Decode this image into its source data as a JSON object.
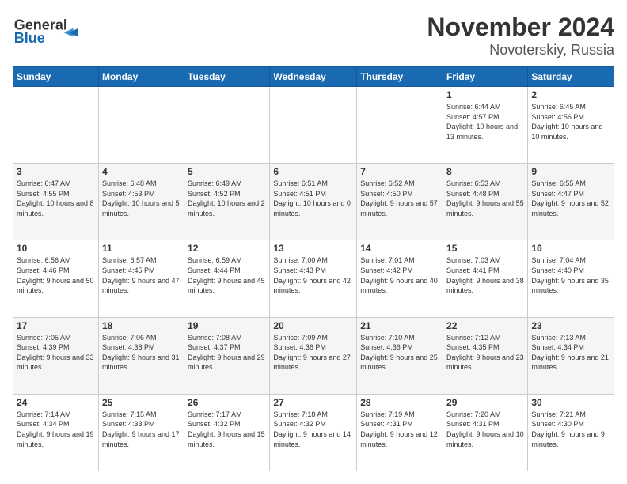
{
  "header": {
    "logo_line1": "General",
    "logo_line2": "Blue",
    "title": "November 2024",
    "subtitle": "Novoterskiy, Russia"
  },
  "days_of_week": [
    "Sunday",
    "Monday",
    "Tuesday",
    "Wednesday",
    "Thursday",
    "Friday",
    "Saturday"
  ],
  "weeks": [
    [
      {
        "day": "",
        "info": ""
      },
      {
        "day": "",
        "info": ""
      },
      {
        "day": "",
        "info": ""
      },
      {
        "day": "",
        "info": ""
      },
      {
        "day": "",
        "info": ""
      },
      {
        "day": "1",
        "info": "Sunrise: 6:44 AM\nSunset: 4:57 PM\nDaylight: 10 hours and 13 minutes."
      },
      {
        "day": "2",
        "info": "Sunrise: 6:45 AM\nSunset: 4:56 PM\nDaylight: 10 hours and 10 minutes."
      }
    ],
    [
      {
        "day": "3",
        "info": "Sunrise: 6:47 AM\nSunset: 4:55 PM\nDaylight: 10 hours and 8 minutes."
      },
      {
        "day": "4",
        "info": "Sunrise: 6:48 AM\nSunset: 4:53 PM\nDaylight: 10 hours and 5 minutes."
      },
      {
        "day": "5",
        "info": "Sunrise: 6:49 AM\nSunset: 4:52 PM\nDaylight: 10 hours and 2 minutes."
      },
      {
        "day": "6",
        "info": "Sunrise: 6:51 AM\nSunset: 4:51 PM\nDaylight: 10 hours and 0 minutes."
      },
      {
        "day": "7",
        "info": "Sunrise: 6:52 AM\nSunset: 4:50 PM\nDaylight: 9 hours and 57 minutes."
      },
      {
        "day": "8",
        "info": "Sunrise: 6:53 AM\nSunset: 4:48 PM\nDaylight: 9 hours and 55 minutes."
      },
      {
        "day": "9",
        "info": "Sunrise: 6:55 AM\nSunset: 4:47 PM\nDaylight: 9 hours and 52 minutes."
      }
    ],
    [
      {
        "day": "10",
        "info": "Sunrise: 6:56 AM\nSunset: 4:46 PM\nDaylight: 9 hours and 50 minutes."
      },
      {
        "day": "11",
        "info": "Sunrise: 6:57 AM\nSunset: 4:45 PM\nDaylight: 9 hours and 47 minutes."
      },
      {
        "day": "12",
        "info": "Sunrise: 6:59 AM\nSunset: 4:44 PM\nDaylight: 9 hours and 45 minutes."
      },
      {
        "day": "13",
        "info": "Sunrise: 7:00 AM\nSunset: 4:43 PM\nDaylight: 9 hours and 42 minutes."
      },
      {
        "day": "14",
        "info": "Sunrise: 7:01 AM\nSunset: 4:42 PM\nDaylight: 9 hours and 40 minutes."
      },
      {
        "day": "15",
        "info": "Sunrise: 7:03 AM\nSunset: 4:41 PM\nDaylight: 9 hours and 38 minutes."
      },
      {
        "day": "16",
        "info": "Sunrise: 7:04 AM\nSunset: 4:40 PM\nDaylight: 9 hours and 35 minutes."
      }
    ],
    [
      {
        "day": "17",
        "info": "Sunrise: 7:05 AM\nSunset: 4:39 PM\nDaylight: 9 hours and 33 minutes."
      },
      {
        "day": "18",
        "info": "Sunrise: 7:06 AM\nSunset: 4:38 PM\nDaylight: 9 hours and 31 minutes."
      },
      {
        "day": "19",
        "info": "Sunrise: 7:08 AM\nSunset: 4:37 PM\nDaylight: 9 hours and 29 minutes."
      },
      {
        "day": "20",
        "info": "Sunrise: 7:09 AM\nSunset: 4:36 PM\nDaylight: 9 hours and 27 minutes."
      },
      {
        "day": "21",
        "info": "Sunrise: 7:10 AM\nSunset: 4:36 PM\nDaylight: 9 hours and 25 minutes."
      },
      {
        "day": "22",
        "info": "Sunrise: 7:12 AM\nSunset: 4:35 PM\nDaylight: 9 hours and 23 minutes."
      },
      {
        "day": "23",
        "info": "Sunrise: 7:13 AM\nSunset: 4:34 PM\nDaylight: 9 hours and 21 minutes."
      }
    ],
    [
      {
        "day": "24",
        "info": "Sunrise: 7:14 AM\nSunset: 4:34 PM\nDaylight: 9 hours and 19 minutes."
      },
      {
        "day": "25",
        "info": "Sunrise: 7:15 AM\nSunset: 4:33 PM\nDaylight: 9 hours and 17 minutes."
      },
      {
        "day": "26",
        "info": "Sunrise: 7:17 AM\nSunset: 4:32 PM\nDaylight: 9 hours and 15 minutes."
      },
      {
        "day": "27",
        "info": "Sunrise: 7:18 AM\nSunset: 4:32 PM\nDaylight: 9 hours and 14 minutes."
      },
      {
        "day": "28",
        "info": "Sunrise: 7:19 AM\nSunset: 4:31 PM\nDaylight: 9 hours and 12 minutes."
      },
      {
        "day": "29",
        "info": "Sunrise: 7:20 AM\nSunset: 4:31 PM\nDaylight: 9 hours and 10 minutes."
      },
      {
        "day": "30",
        "info": "Sunrise: 7:21 AM\nSunset: 4:30 PM\nDaylight: 9 hours and 9 minutes."
      }
    ]
  ]
}
